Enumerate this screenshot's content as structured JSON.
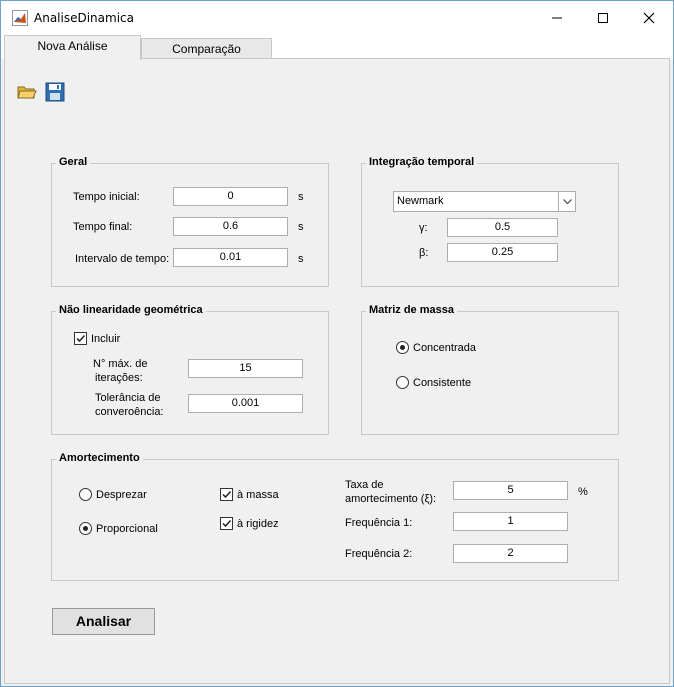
{
  "window": {
    "title": "AnaliseDinamica",
    "minimize": "—",
    "maximize": "☐",
    "close": "✕"
  },
  "tabs": [
    {
      "label": "Nova Análise",
      "active": true
    },
    {
      "label": "Comparação",
      "active": false
    }
  ],
  "toolbar": {
    "open_icon": "folder-open-icon",
    "save_icon": "floppy-disk-icon"
  },
  "geral": {
    "title": "Geral",
    "tempo_inicial": {
      "label": "Tempo inicial:",
      "value": "0",
      "unit": "s"
    },
    "tempo_final": {
      "label": "Tempo final:",
      "value": "0.6",
      "unit": "s"
    },
    "intervalo": {
      "label": "Intervalo de tempo:",
      "value": "0.01",
      "unit": "s"
    }
  },
  "integracao": {
    "title": "Integração temporal",
    "method": "Newmark",
    "gamma": {
      "label": "γ:",
      "value": "0.5"
    },
    "beta": {
      "label": "β:",
      "value": "0.25"
    }
  },
  "nao_linearidade": {
    "title": "Não linearidade geométrica",
    "incluir": {
      "label": "Incluir",
      "checked": true
    },
    "iteracoes": {
      "label_line1": "N° máx. de",
      "label_line2": "iterações:",
      "value": "15"
    },
    "tolerancia": {
      "label_line1": "Tolerância de",
      "label_line2": "converoência:",
      "value": "0.001"
    }
  },
  "matriz_massa": {
    "title": "Matriz de massa",
    "concentrada": {
      "label": "Concentrada",
      "selected": true
    },
    "consistente": {
      "label": "Consistente",
      "selected": false
    }
  },
  "amortecimento": {
    "title": "Amortecimento",
    "desprezar": {
      "label": "Desprezar",
      "selected": false
    },
    "proporcional": {
      "label": "Proporcional",
      "selected": true
    },
    "massa": {
      "label": "à massa",
      "checked": true
    },
    "rigidez": {
      "label": "à rigidez",
      "checked": true
    },
    "taxa": {
      "label_line1": "Taxa de",
      "label_line2": "amortecimento (ξ):",
      "value": "5",
      "unit": "%"
    },
    "freq1": {
      "label": "Frequência 1:",
      "value": "1"
    },
    "freq2": {
      "label": "Frequência 2:",
      "value": "2"
    }
  },
  "actions": {
    "analisar": "Analisar"
  }
}
